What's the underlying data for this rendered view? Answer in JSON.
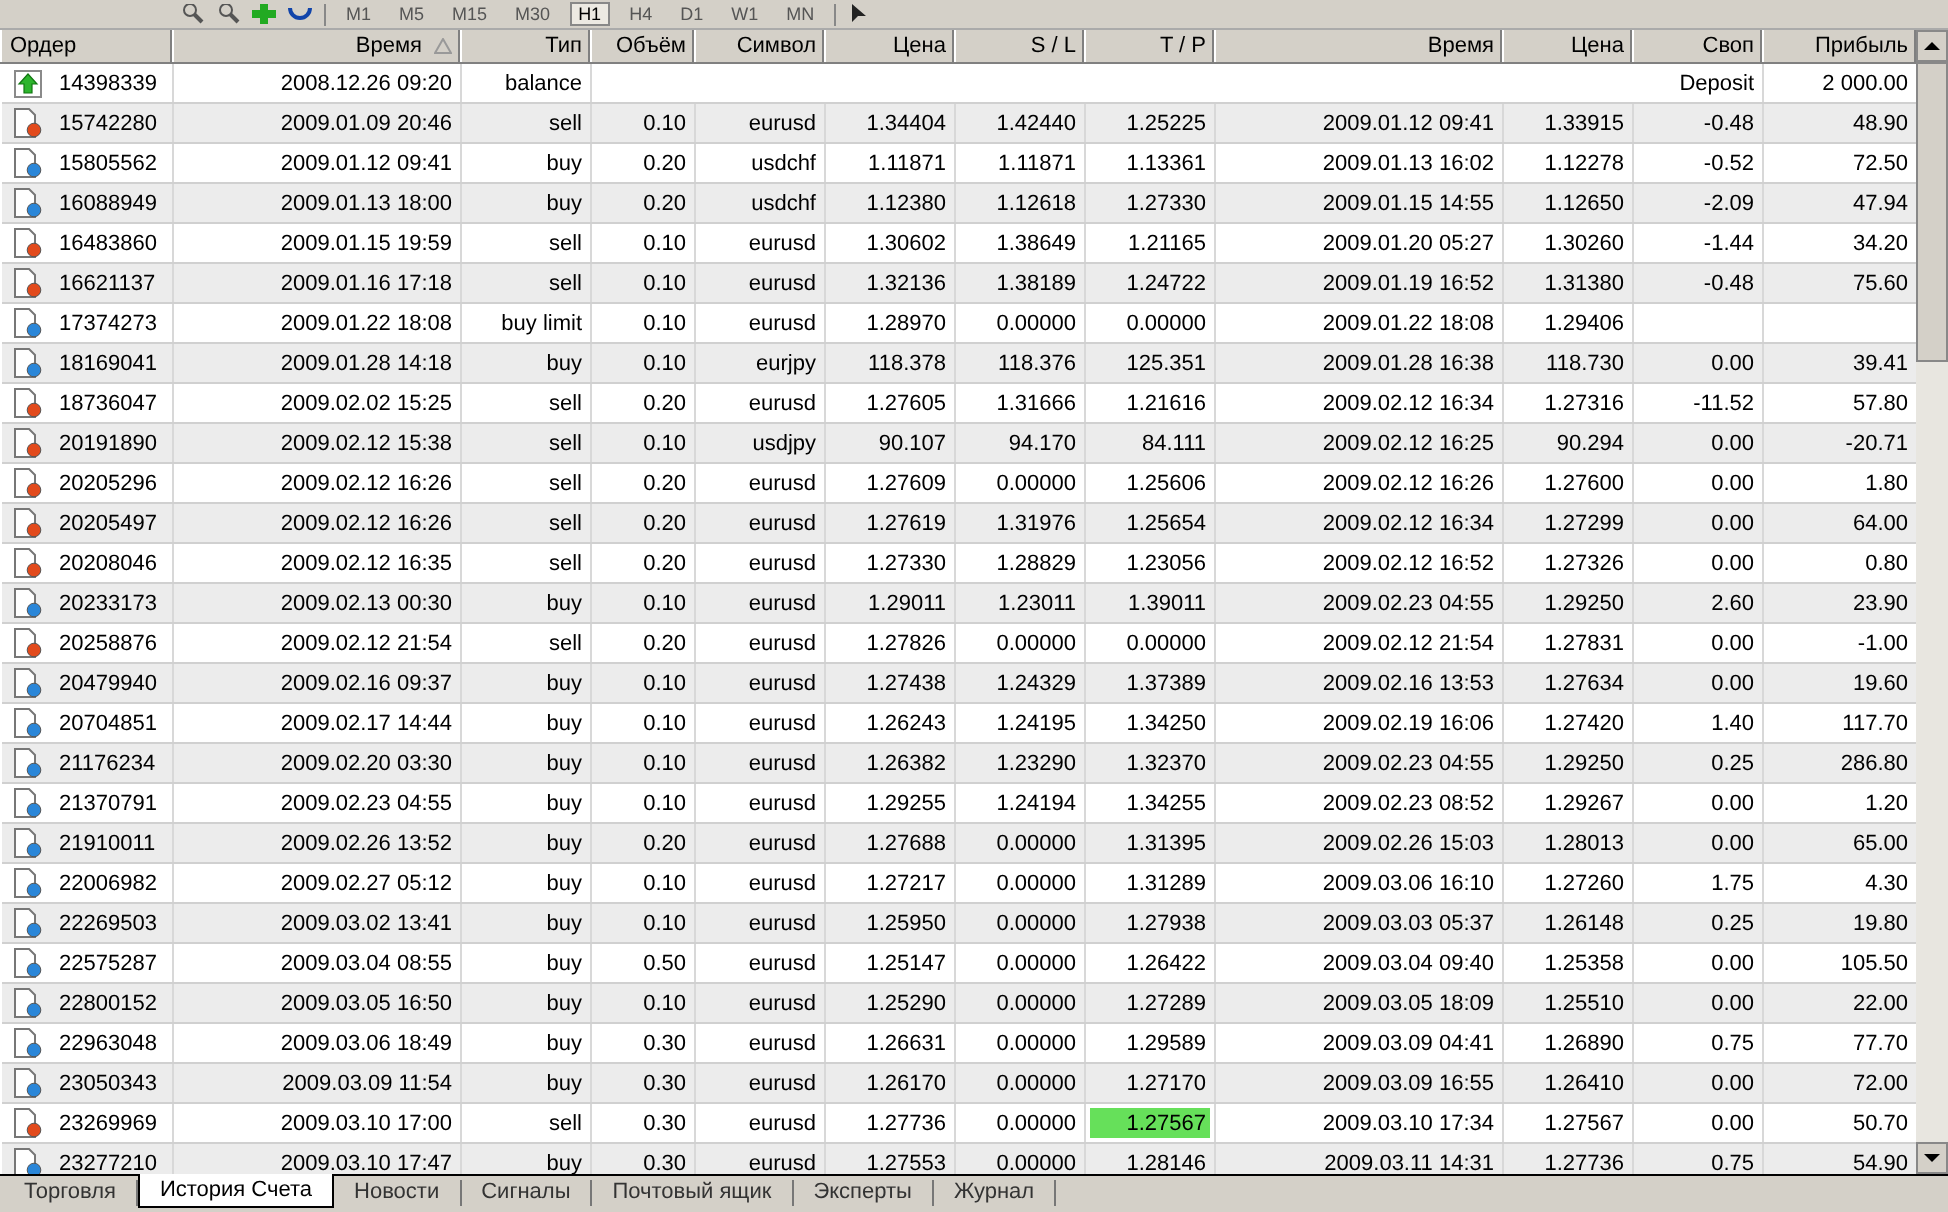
{
  "toolbar": {
    "timeframes": [
      {
        "label": "M1",
        "selected": false
      },
      {
        "label": "M5",
        "selected": false
      },
      {
        "label": "M15",
        "selected": false
      },
      {
        "label": "M30",
        "selected": false
      },
      {
        "label": "H1",
        "selected": true
      },
      {
        "label": "H4",
        "selected": false
      },
      {
        "label": "D1",
        "selected": false
      },
      {
        "label": "W1",
        "selected": false
      },
      {
        "label": "MN",
        "selected": false
      }
    ]
  },
  "table": {
    "columns": [
      {
        "label": "Ордер",
        "sorted": false
      },
      {
        "label": "Время",
        "sorted": true
      },
      {
        "label": "Тип",
        "sorted": false
      },
      {
        "label": "Объём",
        "sorted": false
      },
      {
        "label": "Символ",
        "sorted": false
      },
      {
        "label": "Цена",
        "sorted": false
      },
      {
        "label": "S / L",
        "sorted": false
      },
      {
        "label": "T / P",
        "sorted": false
      },
      {
        "label": "Время",
        "sorted": false
      },
      {
        "label": "Цена",
        "sorted": false
      },
      {
        "label": "Своп",
        "sorted": false
      },
      {
        "label": "Прибыль",
        "sorted": false
      }
    ],
    "rows": [
      {
        "kind": "balance",
        "tp_hit": false,
        "cells": [
          "14398339",
          "2008.12.26 09:20",
          "balance",
          null,
          null,
          null,
          null,
          null,
          null,
          null,
          "Deposit",
          "2 000.00"
        ]
      },
      {
        "kind": "sell",
        "tp_hit": false,
        "cells": [
          "15742280",
          "2009.01.09 20:46",
          "sell",
          "0.10",
          "eurusd",
          "1.34404",
          "1.42440",
          "1.25225",
          "2009.01.12 09:41",
          "1.33915",
          "-0.48",
          "48.90"
        ]
      },
      {
        "kind": "buy",
        "tp_hit": false,
        "cells": [
          "15805562",
          "2009.01.12 09:41",
          "buy",
          "0.20",
          "usdchf",
          "1.11871",
          "1.11871",
          "1.13361",
          "2009.01.13 16:02",
          "1.12278",
          "-0.52",
          "72.50"
        ]
      },
      {
        "kind": "buy",
        "tp_hit": false,
        "cells": [
          "16088949",
          "2009.01.13 18:00",
          "buy",
          "0.20",
          "usdchf",
          "1.12380",
          "1.12618",
          "1.27330",
          "2009.01.15 14:55",
          "1.12650",
          "-2.09",
          "47.94"
        ]
      },
      {
        "kind": "sell",
        "tp_hit": false,
        "cells": [
          "16483860",
          "2009.01.15 19:59",
          "sell",
          "0.10",
          "eurusd",
          "1.30602",
          "1.38649",
          "1.21165",
          "2009.01.20 05:27",
          "1.30260",
          "-1.44",
          "34.20"
        ]
      },
      {
        "kind": "sell",
        "tp_hit": false,
        "cells": [
          "16621137",
          "2009.01.16 17:18",
          "sell",
          "0.10",
          "eurusd",
          "1.32136",
          "1.38189",
          "1.24722",
          "2009.01.19 16:52",
          "1.31380",
          "-0.48",
          "75.60"
        ]
      },
      {
        "kind": "buy",
        "tp_hit": false,
        "cells": [
          "17374273",
          "2009.01.22 18:08",
          "buy limit",
          "0.10",
          "eurusd",
          "1.28970",
          "0.00000",
          "0.00000",
          "2009.01.22 18:08",
          "1.29406",
          null,
          null
        ]
      },
      {
        "kind": "buy",
        "tp_hit": false,
        "cells": [
          "18169041",
          "2009.01.28 14:18",
          "buy",
          "0.10",
          "eurjpy",
          "118.378",
          "118.376",
          "125.351",
          "2009.01.28 16:38",
          "118.730",
          "0.00",
          "39.41"
        ]
      },
      {
        "kind": "sell",
        "tp_hit": false,
        "cells": [
          "18736047",
          "2009.02.02 15:25",
          "sell",
          "0.20",
          "eurusd",
          "1.27605",
          "1.31666",
          "1.21616",
          "2009.02.12 16:34",
          "1.27316",
          "-11.52",
          "57.80"
        ]
      },
      {
        "kind": "sell",
        "tp_hit": false,
        "cells": [
          "20191890",
          "2009.02.12 15:38",
          "sell",
          "0.10",
          "usdjpy",
          "90.107",
          "94.170",
          "84.111",
          "2009.02.12 16:25",
          "90.294",
          "0.00",
          "-20.71"
        ]
      },
      {
        "kind": "sell",
        "tp_hit": false,
        "cells": [
          "20205296",
          "2009.02.12 16:26",
          "sell",
          "0.20",
          "eurusd",
          "1.27609",
          "0.00000",
          "1.25606",
          "2009.02.12 16:26",
          "1.27600",
          "0.00",
          "1.80"
        ]
      },
      {
        "kind": "sell",
        "tp_hit": false,
        "cells": [
          "20205497",
          "2009.02.12 16:26",
          "sell",
          "0.20",
          "eurusd",
          "1.27619",
          "1.31976",
          "1.25654",
          "2009.02.12 16:34",
          "1.27299",
          "0.00",
          "64.00"
        ]
      },
      {
        "kind": "sell",
        "tp_hit": false,
        "cells": [
          "20208046",
          "2009.02.12 16:35",
          "sell",
          "0.20",
          "eurusd",
          "1.27330",
          "1.28829",
          "1.23056",
          "2009.02.12 16:52",
          "1.27326",
          "0.00",
          "0.80"
        ]
      },
      {
        "kind": "buy",
        "tp_hit": false,
        "cells": [
          "20233173",
          "2009.02.13 00:30",
          "buy",
          "0.10",
          "eurusd",
          "1.29011",
          "1.23011",
          "1.39011",
          "2009.02.23 04:55",
          "1.29250",
          "2.60",
          "23.90"
        ]
      },
      {
        "kind": "sell",
        "tp_hit": false,
        "cells": [
          "20258876",
          "2009.02.12 21:54",
          "sell",
          "0.20",
          "eurusd",
          "1.27826",
          "0.00000",
          "0.00000",
          "2009.02.12 21:54",
          "1.27831",
          "0.00",
          "-1.00"
        ]
      },
      {
        "kind": "buy",
        "tp_hit": false,
        "cells": [
          "20479940",
          "2009.02.16 09:37",
          "buy",
          "0.10",
          "eurusd",
          "1.27438",
          "1.24329",
          "1.37389",
          "2009.02.16 13:53",
          "1.27634",
          "0.00",
          "19.60"
        ]
      },
      {
        "kind": "buy",
        "tp_hit": false,
        "cells": [
          "20704851",
          "2009.02.17 14:44",
          "buy",
          "0.10",
          "eurusd",
          "1.26243",
          "1.24195",
          "1.34250",
          "2009.02.19 16:06",
          "1.27420",
          "1.40",
          "117.70"
        ]
      },
      {
        "kind": "buy",
        "tp_hit": false,
        "cells": [
          "21176234",
          "2009.02.20 03:30",
          "buy",
          "0.10",
          "eurusd",
          "1.26382",
          "1.23290",
          "1.32370",
          "2009.02.23 04:55",
          "1.29250",
          "0.25",
          "286.80"
        ]
      },
      {
        "kind": "buy",
        "tp_hit": false,
        "cells": [
          "21370791",
          "2009.02.23 04:55",
          "buy",
          "0.10",
          "eurusd",
          "1.29255",
          "1.24194",
          "1.34255",
          "2009.02.23 08:52",
          "1.29267",
          "0.00",
          "1.20"
        ]
      },
      {
        "kind": "buy",
        "tp_hit": false,
        "cells": [
          "21910011",
          "2009.02.26 13:52",
          "buy",
          "0.20",
          "eurusd",
          "1.27688",
          "0.00000",
          "1.31395",
          "2009.02.26 15:03",
          "1.28013",
          "0.00",
          "65.00"
        ]
      },
      {
        "kind": "buy",
        "tp_hit": false,
        "cells": [
          "22006982",
          "2009.02.27 05:12",
          "buy",
          "0.10",
          "eurusd",
          "1.27217",
          "0.00000",
          "1.31289",
          "2009.03.06 16:10",
          "1.27260",
          "1.75",
          "4.30"
        ]
      },
      {
        "kind": "buy",
        "tp_hit": false,
        "cells": [
          "22269503",
          "2009.03.02 13:41",
          "buy",
          "0.10",
          "eurusd",
          "1.25950",
          "0.00000",
          "1.27938",
          "2009.03.03 05:37",
          "1.26148",
          "0.25",
          "19.80"
        ]
      },
      {
        "kind": "buy",
        "tp_hit": false,
        "cells": [
          "22575287",
          "2009.03.04 08:55",
          "buy",
          "0.50",
          "eurusd",
          "1.25147",
          "0.00000",
          "1.26422",
          "2009.03.04 09:40",
          "1.25358",
          "0.00",
          "105.50"
        ]
      },
      {
        "kind": "buy",
        "tp_hit": false,
        "cells": [
          "22800152",
          "2009.03.05 16:50",
          "buy",
          "0.10",
          "eurusd",
          "1.25290",
          "0.00000",
          "1.27289",
          "2009.03.05 18:09",
          "1.25510",
          "0.00",
          "22.00"
        ]
      },
      {
        "kind": "buy",
        "tp_hit": false,
        "cells": [
          "22963048",
          "2009.03.06 18:49",
          "buy",
          "0.30",
          "eurusd",
          "1.26631",
          "0.00000",
          "1.29589",
          "2009.03.09 04:41",
          "1.26890",
          "0.75",
          "77.70"
        ]
      },
      {
        "kind": "buy",
        "tp_hit": false,
        "cells": [
          "23050343",
          "2009.03.09 11:54",
          "buy",
          "0.30",
          "eurusd",
          "1.26170",
          "0.00000",
          "1.27170",
          "2009.03.09 16:55",
          "1.26410",
          "0.00",
          "72.00"
        ]
      },
      {
        "kind": "sell",
        "tp_hit": true,
        "cells": [
          "23269969",
          "2009.03.10 17:00",
          "sell",
          "0.30",
          "eurusd",
          "1.27736",
          "0.00000",
          "1.27567",
          "2009.03.10 17:34",
          "1.27567",
          "0.00",
          "50.70"
        ]
      },
      {
        "kind": "buy",
        "tp_hit": false,
        "cells": [
          "23277210",
          "2009.03.10 17:47",
          "buy",
          "0.30",
          "eurusd",
          "1.27553",
          "0.00000",
          "1.28146",
          "2009.03.11 14:31",
          "1.27736",
          "0.75",
          "54.90"
        ]
      }
    ]
  },
  "tabs": [
    {
      "label": "Торговля",
      "selected": false
    },
    {
      "label": "История Счета",
      "selected": true
    },
    {
      "label": "Новости",
      "selected": false
    },
    {
      "label": "Сигналы",
      "selected": false
    },
    {
      "label": "Почтовый ящик",
      "selected": false
    },
    {
      "label": "Эксперты",
      "selected": false
    },
    {
      "label": "Журнал",
      "selected": false
    }
  ]
}
